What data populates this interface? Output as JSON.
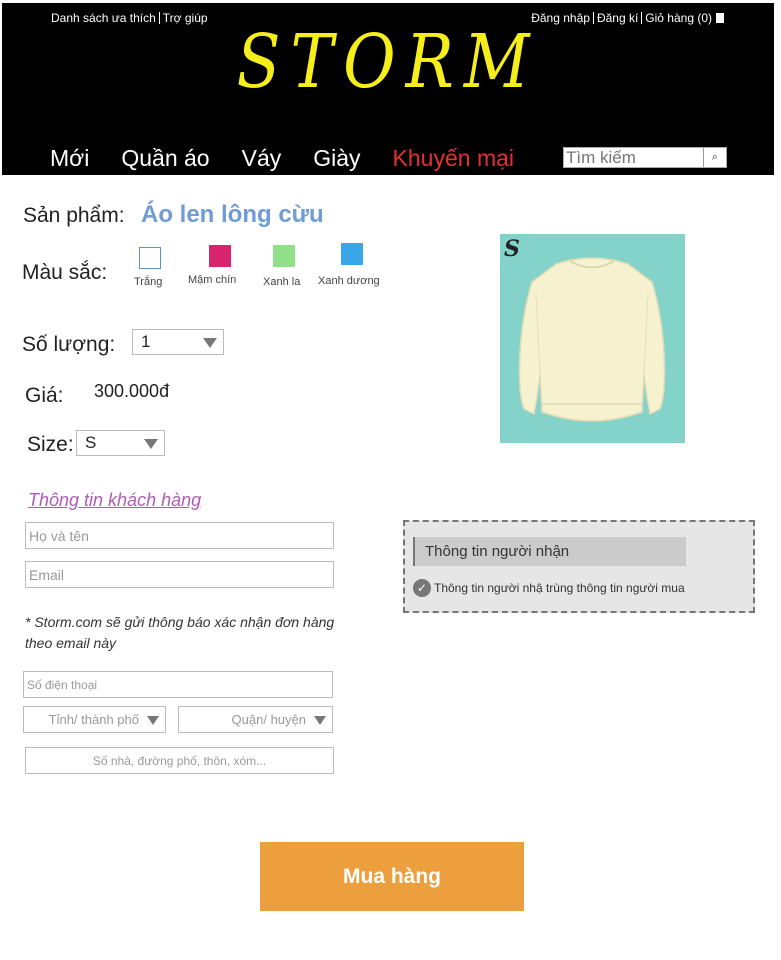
{
  "header": {
    "top_links": {
      "wishlist": "Danh sách ưa thích",
      "help": "Trợ giúp",
      "login": "Đăng nhập",
      "register": "Đăng kí",
      "cart": "Giỏ hàng (0)"
    },
    "logo": "STORM",
    "nav": {
      "new": "Mới",
      "clothes": "Quần áo",
      "dresses": "Váy",
      "shoes": "Giày",
      "sale": "Khuyến mại"
    },
    "search": {
      "placeholder": "Tìm kiếm",
      "icon": "search-icon"
    },
    "colors": {
      "logo": "#f5ee1a",
      "sale": "#e53030"
    }
  },
  "product": {
    "name_label": "Sản phẩm:",
    "name": "Áo len lông cừu",
    "color_label": "Màu sắc:",
    "colors": [
      {
        "label": "Trắng",
        "hex": "#ffffff"
      },
      {
        "label": "Mậm chín",
        "hex": "#d6246e"
      },
      {
        "label": "Xanh la",
        "hex": "#8fe088"
      },
      {
        "label": "Xanh dương",
        "hex": "#3aa6ea"
      }
    ],
    "quantity_label": "Số lượng:",
    "quantity_value": "1",
    "price_label": "Giá:",
    "price": "300.000đ",
    "size_label": "Size:",
    "size_value": "S",
    "image_brand_mark": "S"
  },
  "customer": {
    "section_title": "Thông tin khách hàng",
    "name_placeholder": "Họ và tên",
    "email_placeholder": "Email",
    "note": "* Storm.com sẽ gửi thông báo xác nhận đơn hàng theo email này",
    "phone_placeholder": "Số điện thoại",
    "province_placeholder": "Tỉnh/ thành phố",
    "district_placeholder": "Quận/ huyện",
    "address_placeholder": "Số nhà, đường phố, thôn, xóm..."
  },
  "recipient": {
    "title": "Thông tin người nhận",
    "same_as_buyer": "Thông tin người nhậ trùng thông tin người mua"
  },
  "actions": {
    "buy": "Mua hàng",
    "buy_color": "#ed9f3d"
  }
}
